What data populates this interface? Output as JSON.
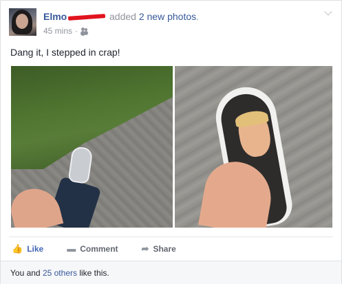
{
  "post": {
    "author": "Elmo",
    "action_prefix": "added",
    "photo_count": "2 new photos",
    "action_suffix": ".",
    "timestamp": "45 mins",
    "separator": "·",
    "audience_icon": "friends-icon",
    "text": "Dang it, I stepped in crap!"
  },
  "actions": {
    "like": "Like",
    "comment": "Comment",
    "share": "Share"
  },
  "likes": {
    "prefix": "You and",
    "others": "25 others",
    "suffix": "like this."
  },
  "colors": {
    "link": "#365899",
    "like_active": "#4267b2",
    "redaction": "#e0141e"
  }
}
